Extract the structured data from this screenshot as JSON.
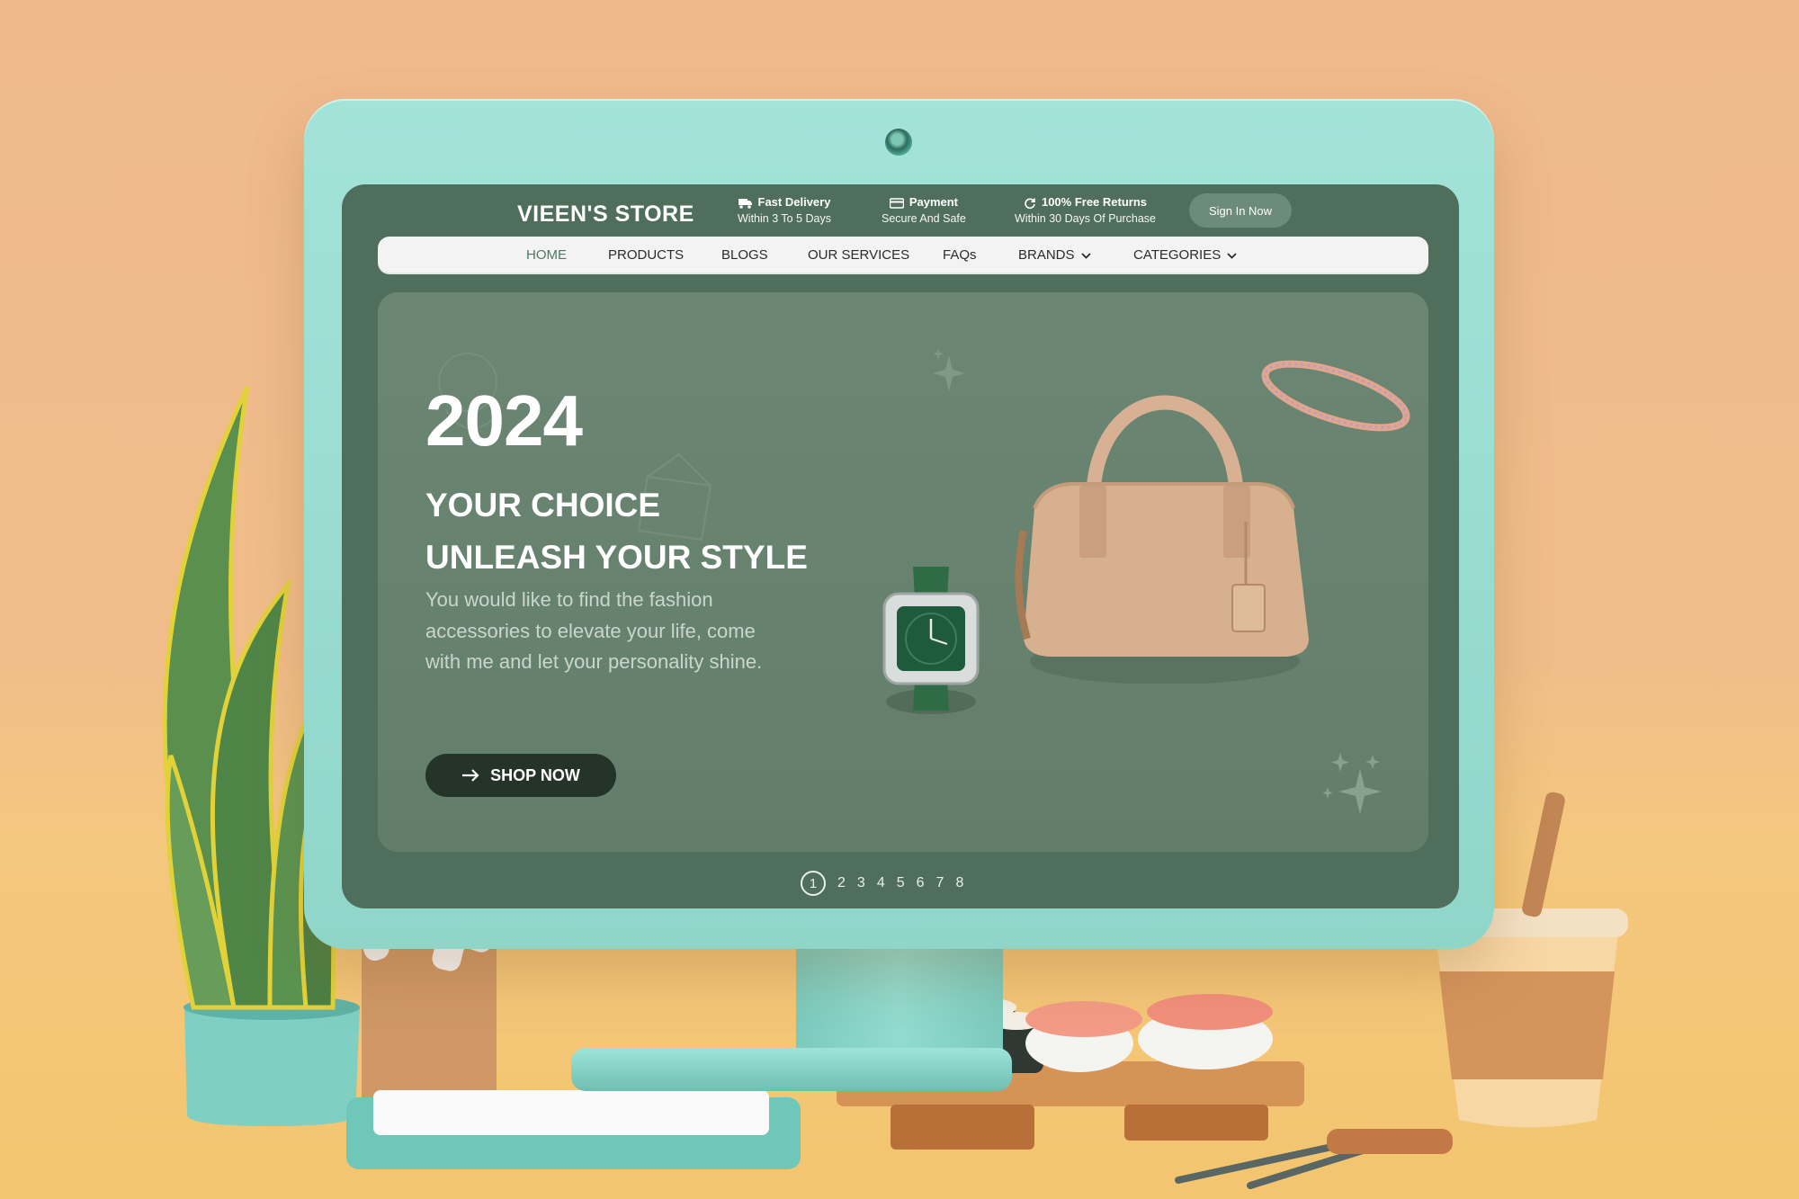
{
  "store": {
    "logo": "VIEEN'S STORE",
    "features": [
      {
        "title": "Fast Delivery",
        "subtitle": "Within 3 To 5 Days",
        "icon": "truck-icon"
      },
      {
        "title": "Payment",
        "subtitle": "Secure And Safe",
        "icon": "card-icon"
      },
      {
        "title": "100% Free Returns",
        "subtitle": "Within 30 Days Of Purchase",
        "icon": "refresh-icon"
      }
    ],
    "signin_label": "Sign In Now"
  },
  "nav": {
    "items": [
      {
        "label": "HOME",
        "active": true
      },
      {
        "label": "PRODUCTS"
      },
      {
        "label": "BLOGS"
      },
      {
        "label": "OUR SERVICES"
      },
      {
        "label": "FAQs"
      },
      {
        "label": "BRANDS",
        "dropdown": true
      },
      {
        "label": "CATEGORIES",
        "dropdown": true
      }
    ]
  },
  "hero": {
    "year": "2024",
    "headline_1": "YOUR CHOICE",
    "headline_2": "UNLEASH YOUR STYLE",
    "description": "You would like to find the fashion accessories to elevate your life, come with me and let your personality shine.",
    "cta_label": "SHOP NOW"
  },
  "pager": {
    "pages": [
      "1",
      "2",
      "3",
      "4",
      "5",
      "6",
      "7",
      "8"
    ],
    "current": "1"
  },
  "colors": {
    "screen_bg": "#4f6e5b",
    "hero_bg": "#6b8673",
    "cta_bg": "#253428",
    "monitor": "#9fe0d5",
    "backdrop": "#efb98c"
  }
}
